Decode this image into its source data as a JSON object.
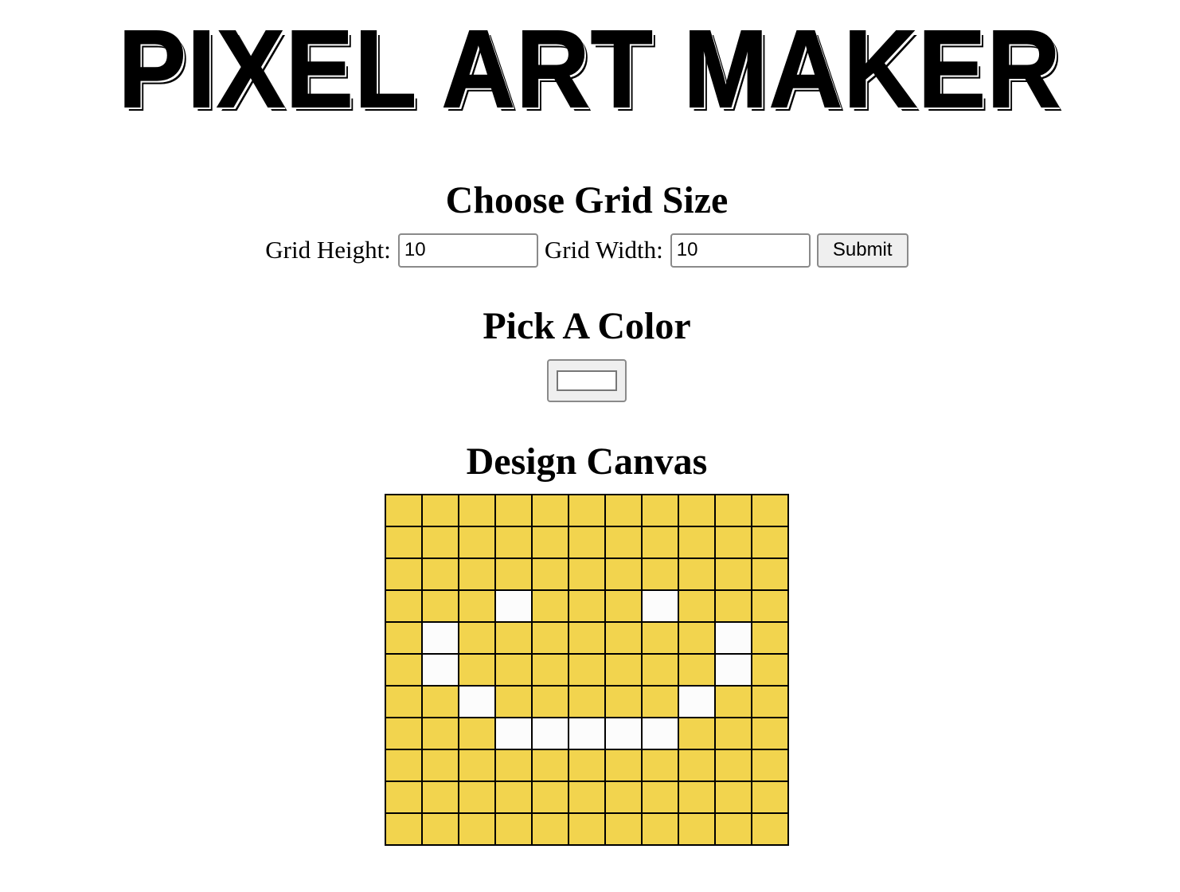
{
  "header": {
    "title": "Pixel Art Maker"
  },
  "grid_size": {
    "heading": "Choose Grid Size",
    "height_label": "Grid Height:",
    "height_value": "10",
    "width_label": "Grid Width:",
    "width_value": "10",
    "submit_label": "Submit"
  },
  "color": {
    "heading": "Pick A Color",
    "selected_value": "#ffffff"
  },
  "canvas": {
    "heading": "Design Canvas",
    "colors": {
      "fill": "#f2d44e",
      "empty": "#fcfcfc"
    },
    "cells": [
      "11111111111",
      "11111111111",
      "11111111111",
      "11101110111",
      "10111111101",
      "10111111101",
      "11011111011",
      "11100000111",
      "11111111111",
      "11111111111",
      "11111111111"
    ]
  }
}
